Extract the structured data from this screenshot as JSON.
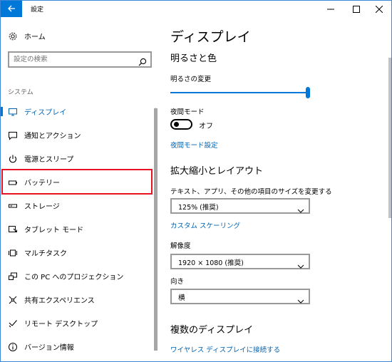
{
  "window": {
    "title": "設定"
  },
  "sidebar": {
    "home_label": "ホーム",
    "search_placeholder": "設定の検索",
    "section_title": "システム",
    "items": [
      {
        "label": "ディスプレイ",
        "icon": "monitor-icon",
        "selected": true
      },
      {
        "label": "通知とアクション",
        "icon": "notification-icon"
      },
      {
        "label": "電源とスリープ",
        "icon": "power-icon"
      },
      {
        "label": "バッテリー",
        "icon": "battery-icon",
        "highlighted": true
      },
      {
        "label": "ストレージ",
        "icon": "storage-icon"
      },
      {
        "label": "タブレット モード",
        "icon": "tablet-mode-icon"
      },
      {
        "label": "マルチタスク",
        "icon": "multitasking-icon"
      },
      {
        "label": "この PC へのプロジェクション",
        "icon": "projection-icon"
      },
      {
        "label": "共有エクスペリエンス",
        "icon": "shared-experiences-icon"
      },
      {
        "label": "リモート デスクトップ",
        "icon": "remote-desktop-icon"
      },
      {
        "label": "バージョン情報",
        "icon": "info-icon"
      }
    ]
  },
  "main": {
    "page_title": "ディスプレイ",
    "brightness_section": {
      "heading": "明るさと色",
      "brightness_label": "明るさの変更",
      "brightness_value": 1.0,
      "night_mode_label": "夜間モード",
      "night_mode_state": "オフ",
      "night_mode_settings_link": "夜間モード設定"
    },
    "scale_section": {
      "heading": "拡大縮小とレイアウト",
      "scale_label": "テキスト、アプリ、その他の項目のサイズを変更する",
      "scale_value": "125% (推奨)",
      "custom_scaling_link": "カスタム スケーリング",
      "resolution_label": "解像度",
      "resolution_value": "1920 × 1080 (推奨)",
      "orientation_label": "向き",
      "orientation_value": "横"
    },
    "multi_display": {
      "heading": "複数のディスプレイ",
      "wireless_link": "ワイヤレス ディスプレイに接続する"
    }
  },
  "colors": {
    "accent": "#0078d7",
    "link": "#0063b1",
    "highlight_border": "#e81123"
  }
}
